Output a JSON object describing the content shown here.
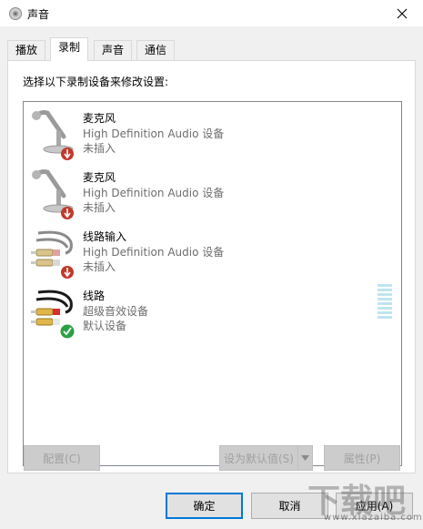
{
  "window": {
    "title": "声音",
    "icon": "speaker-icon",
    "close_icon": "close-icon"
  },
  "tabs": [
    {
      "label": "播放",
      "active": false
    },
    {
      "label": "录制",
      "active": true
    },
    {
      "label": "声音",
      "active": false
    },
    {
      "label": "通信",
      "active": false
    }
  ],
  "panel": {
    "instruction": "选择以下录制设备来修改设置:"
  },
  "devices": [
    {
      "name": "麦克风",
      "description": "High Definition Audio 设备",
      "status": "未插入",
      "icon": "microphone-icon",
      "badge": "unplugged-badge-icon"
    },
    {
      "name": "麦克风",
      "description": "High Definition Audio 设备",
      "status": "未插入",
      "icon": "microphone-icon",
      "badge": "unplugged-badge-icon"
    },
    {
      "name": "线路输入",
      "description": "High Definition Audio 设备",
      "status": "未插入",
      "icon": "rca-cable-icon",
      "badge": "unplugged-badge-icon"
    },
    {
      "name": "线路",
      "description": "超级音效设备",
      "status": "默认设备",
      "icon": "rca-cable-icon",
      "badge": "default-check-icon"
    }
  ],
  "buttons": {
    "configure": "配置(C)",
    "set_default": "设为默认值(S)",
    "properties": "属性(P)",
    "ok": "确定",
    "cancel": "取消",
    "apply": "应用(A)"
  },
  "watermark": {
    "text": "下载吧",
    "url": "www.xiazaiba.com"
  },
  "colors": {
    "accent": "#0078d7",
    "check": "#2ea043",
    "unplugged": "#c0392b",
    "level": "#bfe5ef"
  }
}
